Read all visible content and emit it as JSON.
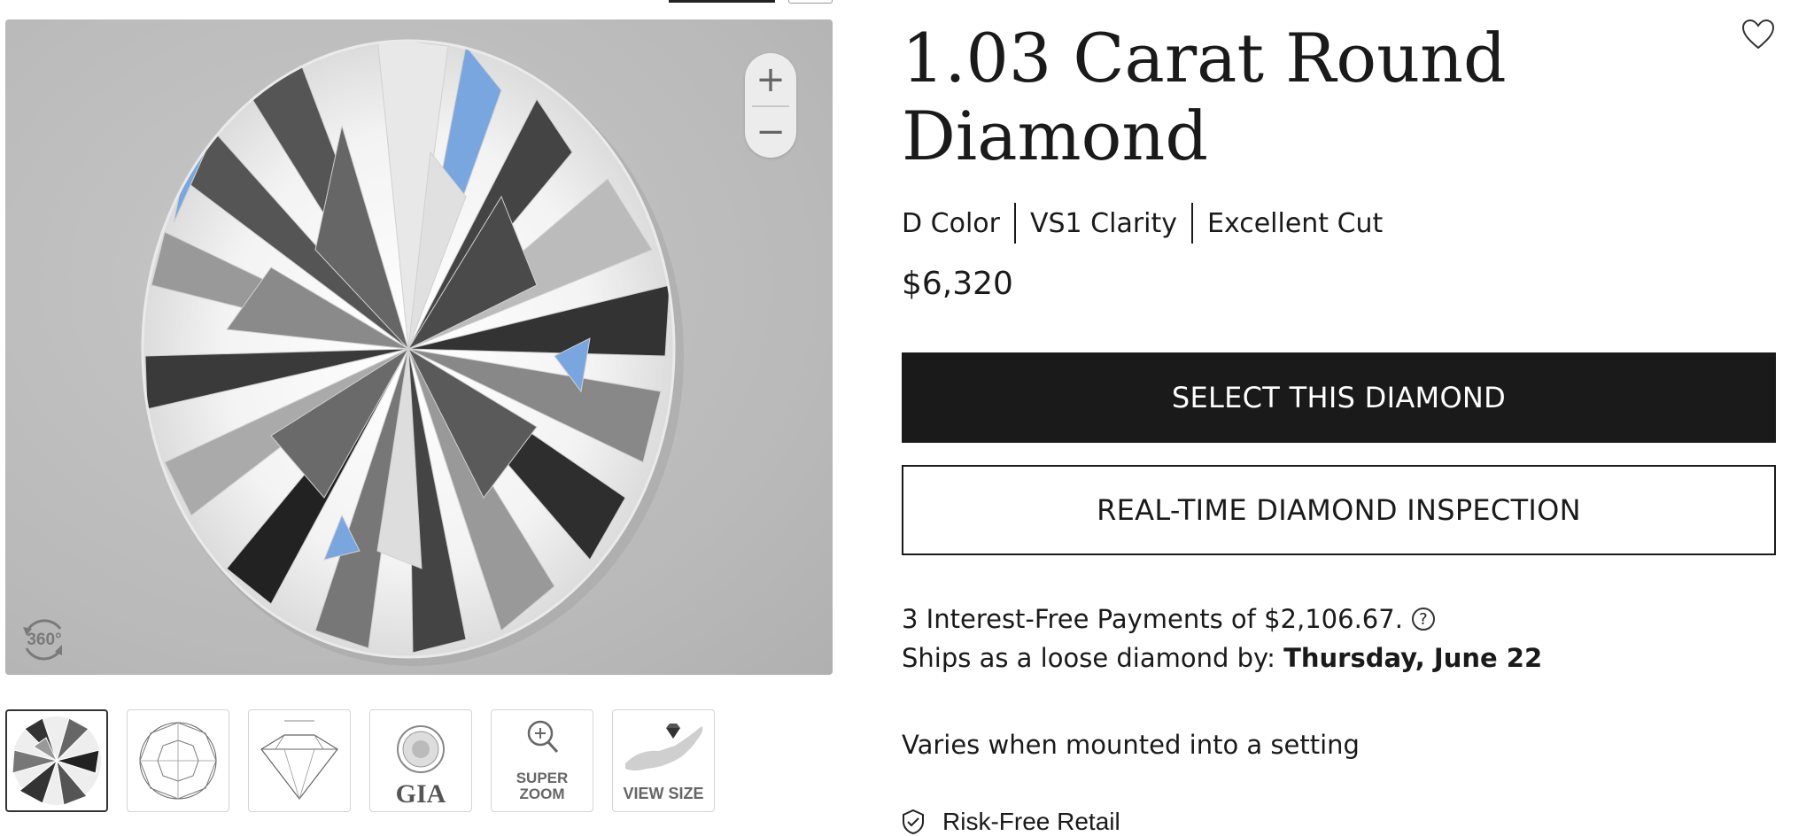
{
  "product": {
    "title_line1": "1.03 Carat Round",
    "title_line2": "Diamond",
    "specs": [
      "D Color",
      "VS1 Clarity",
      "Excellent Cut"
    ],
    "price": "$6,320"
  },
  "actions": {
    "select_label": "SELECT THIS DIAMOND",
    "inspection_label": "REAL-TIME DIAMOND INSPECTION"
  },
  "payment": {
    "text": "3 Interest-Free Payments of $2,106.67.",
    "help_icon": "?"
  },
  "shipping": {
    "prefix": "Ships as a loose diamond by:",
    "date": "Thursday, June 22",
    "note": "Varies when mounted into a setting"
  },
  "features": {
    "risk_free": "Risk-Free Retail"
  },
  "viewer": {
    "zoom_in": "+",
    "zoom_out": "−",
    "rotate_label": "360°"
  },
  "thumbnails": [
    {
      "name": "diamond-photo",
      "label": ""
    },
    {
      "name": "top-view-diagram",
      "label": ""
    },
    {
      "name": "side-profile-diagram",
      "label": ""
    },
    {
      "name": "gia-certificate",
      "label": "GIA"
    },
    {
      "name": "super-zoom",
      "label_line1": "SUPER",
      "label_line2": "ZOOM"
    },
    {
      "name": "view-size",
      "label": "VIEW SIZE"
    }
  ],
  "icons": {
    "favorite": "heart-icon",
    "help": "question-circle-icon",
    "rotate": "rotate-360-icon",
    "risk_free": "shield-check-icon",
    "zoom": "magnifier-plus-icon"
  },
  "colors": {
    "primary_button": "#1a1a1a",
    "viewer_bg": "#bcbcbc",
    "text": "#1a1a1a"
  }
}
